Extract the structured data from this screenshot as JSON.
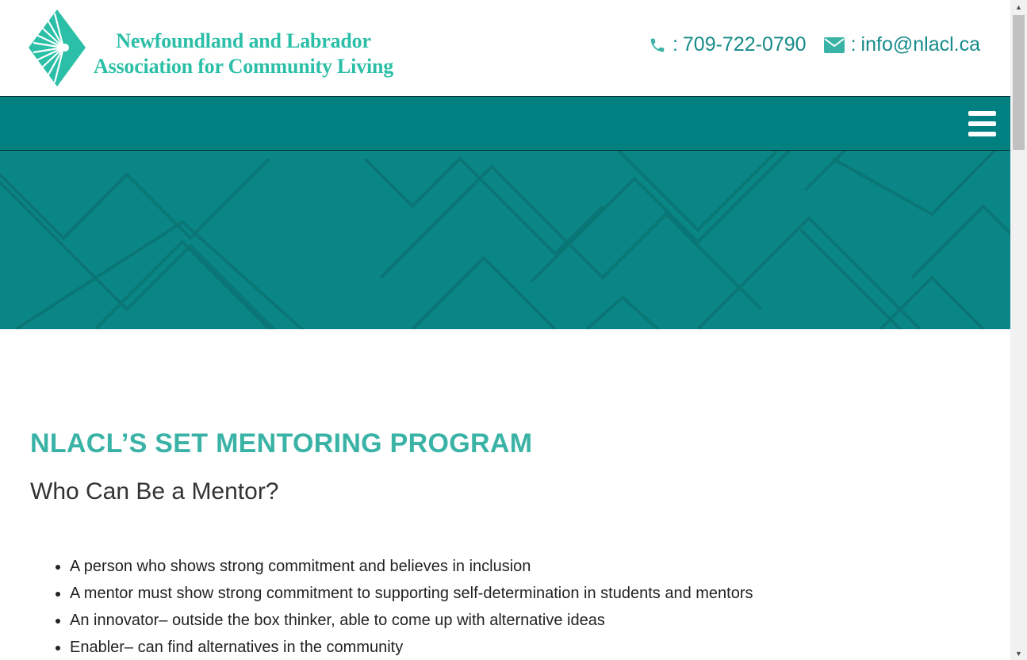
{
  "header": {
    "logo_line1": "Newfoundland and Labrador",
    "logo_line2": "Association for Community Living",
    "phone_sep": ":",
    "phone": "709-722-0790",
    "email_sep": ":",
    "email": "info@nlacl.ca",
    "phone_icon": "phone-icon",
    "email_icon": "envelope-icon"
  },
  "nav": {
    "menu_icon": "hamburger-menu-icon"
  },
  "main": {
    "title": "NLACL’S SET MENTORING PROGRAM",
    "subtitle": "Who Can Be a Mentor?",
    "bullets": [
      "A person who shows strong commitment and believes in inclusion",
      "A mentor must show strong commitment to supporting self-determination in students and mentors",
      "An innovator– outside the box thinker, able to come up with alternative ideas",
      "Enabler– can find alternatives in the community"
    ]
  },
  "colors": {
    "brand_teal": "#018082",
    "hero_teal": "#0b8686",
    "logo_green": "#2bbfa7",
    "title_teal": "#3ab3a6",
    "contact_teal": "#168a8a"
  }
}
